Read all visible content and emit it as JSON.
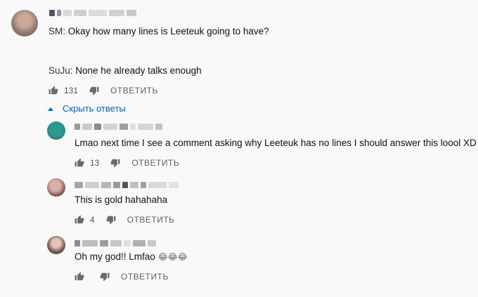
{
  "main_comment": {
    "lines": [
      {
        "speaker": "SM:",
        "text": " Okay how many lines is Leeteuk going to have?"
      },
      {
        "speaker": "SuJu:",
        "text": " None he already talks enough"
      }
    ],
    "likes": "131",
    "reply_label": "ОТВЕТИТЬ"
  },
  "replies_toggle": {
    "label": "Скрыть ответы",
    "icon": "caret-up-icon"
  },
  "replies": [
    {
      "text": "Lmao next time I see a comment asking why Leeteuk has no lines I should answer this loool XD",
      "likes": "13",
      "reply_label": "ОТВЕТИТЬ"
    },
    {
      "text": "This is gold hahahaha",
      "likes": "4",
      "reply_label": "ОТВЕТИТЬ"
    },
    {
      "text": "Oh my god!! Lmfao ",
      "emoji": "😂😂😂",
      "likes": "",
      "reply_label": "ОТВЕТИТЬ"
    }
  ],
  "colors": {
    "link": "#065fd4",
    "muted": "#606060",
    "background": "#f9f9f9"
  }
}
